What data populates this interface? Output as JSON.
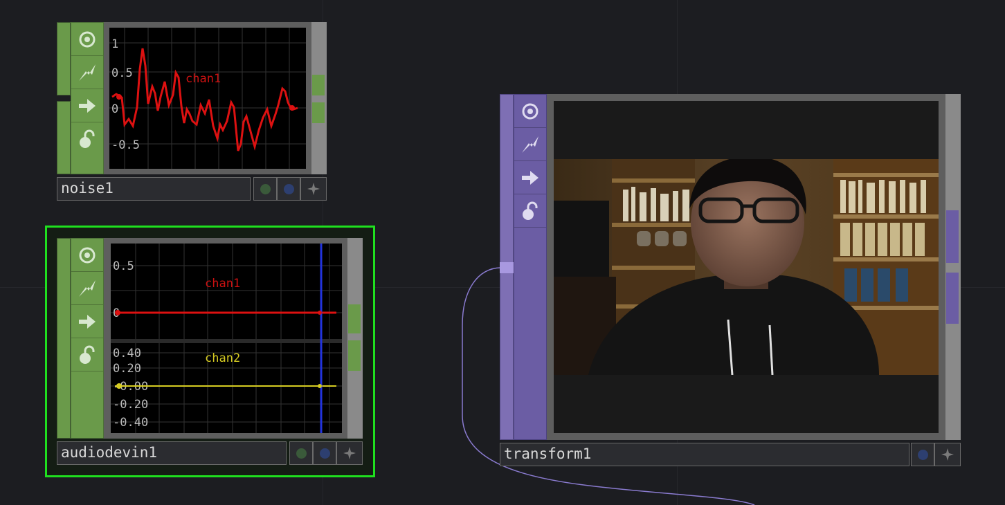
{
  "nodes": {
    "noise1": {
      "name": "noise1",
      "y_ticks": [
        "1",
        "0.5",
        "0",
        "-0.5"
      ],
      "channel": "chan1",
      "channel_color": "#cc1111",
      "node_color": "#6a9a4a"
    },
    "audiodevin1": {
      "name": "audiodevin1",
      "chan1_ticks": [
        "0.5",
        "0"
      ],
      "chan2_ticks": [
        "0.40",
        "0.20",
        "-0.00",
        "-0.20",
        "-0.40"
      ],
      "channels": [
        "chan1",
        "chan2"
      ],
      "chan1_color": "#cc1111",
      "chan2_color": "#d6cc22",
      "playhead_color": "#2233dd",
      "selection_color": "#1fe01f",
      "node_color": "#6a9a4a"
    },
    "transform1": {
      "name": "transform1",
      "node_color": "#7e6fb4"
    }
  },
  "icons": [
    "viewer-icon",
    "bypass-icon",
    "export-icon",
    "lock-icon",
    "display-flag-icon",
    "render-flag-icon",
    "add-icon"
  ],
  "wire_color": "#8a7bd0",
  "background": "#1c1d21"
}
